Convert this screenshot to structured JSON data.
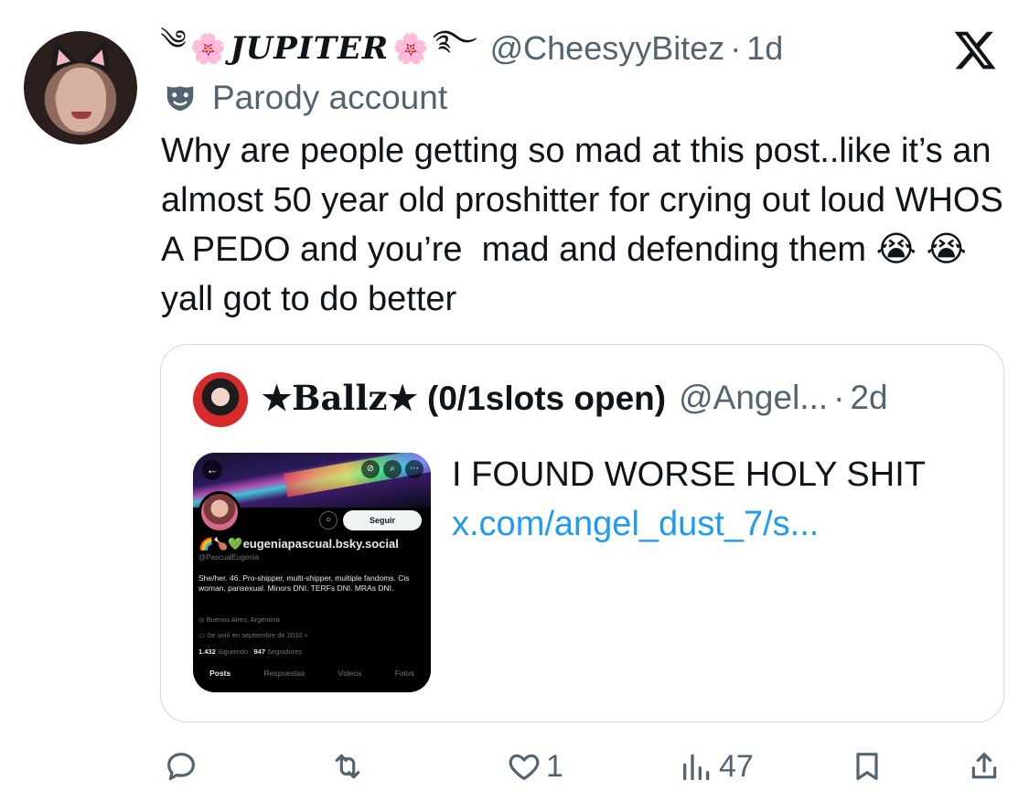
{
  "tweet": {
    "display_name": "JUPITER",
    "handle": "@CheesyyBitez",
    "time": "1d",
    "label": "Parody account",
    "text": "Why are people getting so mad at this post..like it’s an almost 50 year old proshitter for crying out loud WHOS A PEDO and you’re  mad and defending them 😭 😭  yall got to do better"
  },
  "quote": {
    "display_name": "Ballz",
    "display_suffix": "(0/1slots open)",
    "handle": "@Angel...",
    "time": "2d",
    "text": "I FOUND WORSE HOLY SHIT",
    "link": "x.com/angel_dust_7/s..."
  },
  "screenshot_card": {
    "follow_label": "Seguir",
    "name": "eugeniapascual.bsky.social",
    "handle": "@PascualEugenia",
    "bio": "She/her. 46. Pro-shipper, multi-shipper, multiple fandoms. Cis woman, pansexual. Minors DNI. TERFs DNI. MRAs DNI.",
    "location": "Buenos Aires, Argentina",
    "joined": "Se unió en septiembre de 2010 >",
    "following_count": "1.432",
    "following_label": "Siguiendo",
    "followers_count": "947",
    "followers_label": "Seguidores",
    "tabs": [
      "Posts",
      "Respuestas",
      "Videos",
      "Fotos"
    ]
  },
  "actions": {
    "reply_count": "",
    "repost_count": "",
    "like_count": "1",
    "views_count": "47"
  },
  "icons": {
    "platform": "x-logo-icon",
    "parody": "mask-icon",
    "reply": "reply-icon",
    "repost": "repost-icon",
    "like": "heart-icon",
    "views": "views-icon",
    "bookmark": "bookmark-icon",
    "share": "share-icon"
  },
  "colors": {
    "text": "#0f1419",
    "secondary": "#536471",
    "link": "#1d9bf0",
    "border": "#cfd9de"
  }
}
